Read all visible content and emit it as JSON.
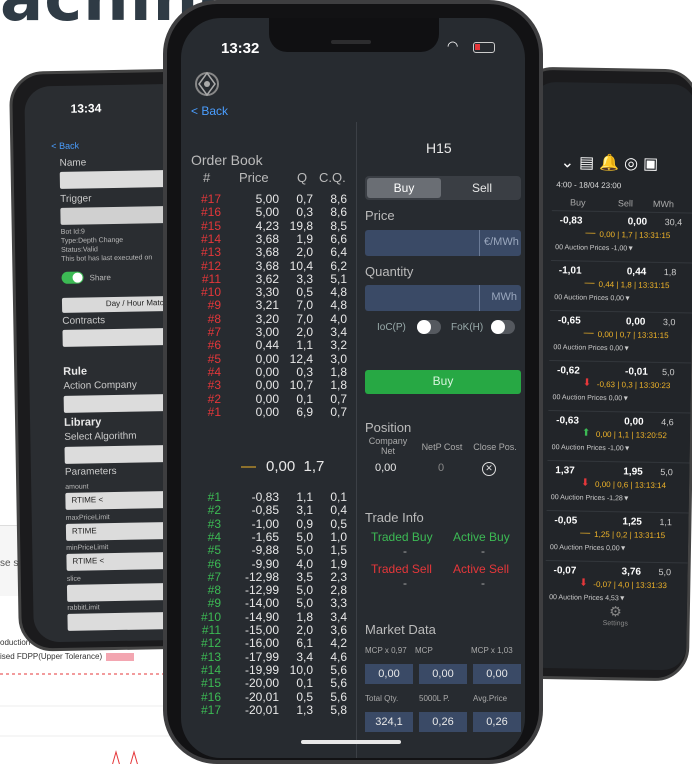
{
  "hero_title": "aching",
  "background_chart": {
    "snippet": "se s",
    "legend_production": "oduction",
    "legend_fdpp": "ised FDPP(Upper Tolerance)"
  },
  "left_phone": {
    "time": "13:34",
    "back": "< Back",
    "name_label": "Name",
    "trigger_label": "Trigger",
    "trigger_value": "Depth C",
    "bot_id": "Bot Id:9",
    "bot_type": "Type:Depth Change",
    "bot_status": "Status:Valid",
    "bot_last": "This bot has last executed on",
    "share_label": "Share",
    "day_hour_button": "Day / Hour Match",
    "contracts_label": "Contracts",
    "contracts_select": "Sele",
    "rule_heading": "Rule",
    "action_company_label": "Action Company",
    "library_heading": "Library",
    "select_algorithm_label": "Select Algorithm",
    "parameters_label": "Parameters",
    "amount_label": "amount",
    "amount_value": "RTIME <",
    "max_price_label": "maxPriceLimit",
    "max_price_value": "RTIME",
    "min_price_label": "minPriceLimit",
    "min_price_value": "RTIME <",
    "slice_label": "slice",
    "rabbit_label": "rabbitLimit"
  },
  "right_phone": {
    "date_range": "4:00 - 18/04 23:00",
    "headers": [
      "Buy",
      "Sell",
      "MWh"
    ],
    "settings_label": "Settings",
    "rows": [
      {
        "buy": "-0,83",
        "sell": "0,00",
        "mwh": "30,4",
        "detail": "0,00 | 1,7 | 13:31:15",
        "auction": "00  Auction Prices  -1,00▼",
        "arrow": "—",
        "arrow_color": "#f0b429"
      },
      {
        "buy": "-1,01",
        "sell": "0,44",
        "mwh": "1,8",
        "detail": "0,44 | 1,8 | 13:31:15",
        "auction": "00  Auction Prices  0,00▼",
        "arrow": "—",
        "arrow_color": "#f0b429"
      },
      {
        "buy": "-0,65",
        "sell": "0,00",
        "mwh": "3,0",
        "detail": "0,00 | 0,7 | 13:31:15",
        "auction": "00  Auction Prices  0,00▼",
        "arrow": "—",
        "arrow_color": "#f0b429"
      },
      {
        "buy": "-0,62",
        "sell": "-0,01",
        "mwh": "5,0",
        "detail": "-0,63 | 0,3 | 13:30:23",
        "auction": "00  Auction Prices  0,00▼",
        "arrow": "⬇",
        "arrow_color": "#e5373a"
      },
      {
        "buy": "-0,63",
        "sell": "0,00",
        "mwh": "4,6",
        "detail": "0,00 | 1,1 | 13:20:52",
        "auction": "00  Auction Prices  -1,00▼",
        "arrow": "⬆",
        "arrow_color": "#3cba54"
      },
      {
        "buy": "1,37",
        "sell": "1,95",
        "mwh": "5,0",
        "detail": "0,00 | 0,6 | 13:13:14",
        "auction": "00  Auction Prices  -1,28▼",
        "arrow": "⬇",
        "arrow_color": "#e5373a"
      },
      {
        "buy": "-0,05",
        "sell": "1,25",
        "mwh": "1,1",
        "detail": "1,25 | 0,2 | 13:31:15",
        "auction": "00  Auction Prices  0,00▼",
        "arrow": "—",
        "arrow_color": "#f0b429"
      },
      {
        "buy": "-0,07",
        "sell": "3,76",
        "mwh": "5,0",
        "detail": "-0,07 | 4,0 | 13:31:33",
        "auction": "00  Auction Prices  4,53▼",
        "arrow": "⬇",
        "arrow_color": "#e5373a"
      }
    ]
  },
  "center_phone": {
    "time": "13:32",
    "back": "< Back",
    "order_book_title": "Order Book",
    "columns": [
      "#",
      "Price",
      "Q",
      "C.Q."
    ],
    "sell_orders": [
      [
        "#17",
        "5,00",
        "0,7",
        "8,6"
      ],
      [
        "#16",
        "5,00",
        "0,3",
        "8,6"
      ],
      [
        "#15",
        "4,23",
        "19,8",
        "8,5"
      ],
      [
        "#14",
        "3,68",
        "1,9",
        "6,6"
      ],
      [
        "#13",
        "3,68",
        "2,0",
        "6,4"
      ],
      [
        "#12",
        "3,68",
        "10,4",
        "6,2"
      ],
      [
        "#11",
        "3,62",
        "3,3",
        "5,1"
      ],
      [
        "#10",
        "3,30",
        "0,5",
        "4,8"
      ],
      [
        "#9",
        "3,21",
        "7,0",
        "4,8"
      ],
      [
        "#8",
        "3,20",
        "7,0",
        "4,0"
      ],
      [
        "#7",
        "3,00",
        "2,0",
        "3,4"
      ],
      [
        "#6",
        "0,44",
        "1,1",
        "3,2"
      ],
      [
        "#5",
        "0,00",
        "12,4",
        "3,0"
      ],
      [
        "#4",
        "0,00",
        "0,3",
        "1,8"
      ],
      [
        "#3",
        "0,00",
        "10,7",
        "1,8"
      ],
      [
        "#2",
        "0,00",
        "0,1",
        "0,7"
      ],
      [
        "#1",
        "0,00",
        "6,9",
        "0,7"
      ]
    ],
    "mid_price": "0,00",
    "mid_qty": "1,7",
    "mid_dash": "—",
    "buy_orders": [
      [
        "#1",
        "-0,83",
        "1,1",
        "0,1"
      ],
      [
        "#2",
        "-0,85",
        "3,1",
        "0,4"
      ],
      [
        "#3",
        "-1,00",
        "0,9",
        "0,5"
      ],
      [
        "#4",
        "-1,65",
        "5,0",
        "1,0"
      ],
      [
        "#5",
        "-9,88",
        "5,0",
        "1,5"
      ],
      [
        "#6",
        "-9,90",
        "4,0",
        "1,9"
      ],
      [
        "#7",
        "-12,98",
        "3,5",
        "2,3"
      ],
      [
        "#8",
        "-12,99",
        "5,0",
        "2,8"
      ],
      [
        "#9",
        "-14,00",
        "5,0",
        "3,3"
      ],
      [
        "#10",
        "-14,90",
        "1,8",
        "3,4"
      ],
      [
        "#11",
        "-15,00",
        "2,0",
        "3,6"
      ],
      [
        "#12",
        "-16,00",
        "6,1",
        "4,2"
      ],
      [
        "#13",
        "-17,99",
        "3,4",
        "4,6"
      ],
      [
        "#14",
        "-19,99",
        "10,0",
        "5,6"
      ],
      [
        "#15",
        "-20,00",
        "0,1",
        "5,6"
      ],
      [
        "#16",
        "-20,01",
        "0,5",
        "5,6"
      ],
      [
        "#17",
        "-20,01",
        "1,3",
        "5,8"
      ]
    ],
    "contract": "H15",
    "buy_tab": "Buy",
    "sell_tab": "Sell",
    "price_label": "Price",
    "price_unit": "€/MWh",
    "quantity_label": "Quantity",
    "quantity_unit": "MWh",
    "ioc_label": "IoC(P)",
    "fok_label": "FoK(H)",
    "buy_button": "Buy",
    "position_label": "Position",
    "company_net_label": "Company Net",
    "netp_cost_label": "NetP Cost",
    "close_pos_label": "Close Pos.",
    "company_net_value": "0,00",
    "netp_cost_value": "0",
    "trade_info_label": "Trade Info",
    "traded_buy_label": "Traded Buy",
    "active_buy_label": "Active Buy",
    "traded_buy_value": "-",
    "active_buy_value": "-",
    "traded_sell_label": "Traded Sell",
    "active_sell_label": "Active Sell",
    "traded_sell_value": "-",
    "active_sell_value": "-",
    "market_data_label": "Market Data",
    "mcp_low_label": "MCP x 0,97",
    "mcp_label": "MCP",
    "mcp_high_label": "MCP x 1,03",
    "mcp_low_value": "0,00",
    "mcp_value": "0,00",
    "mcp_high_value": "0,00",
    "total_qty_label": "Total Qty.",
    "p5000_label": "5000L P.",
    "avg_price_label": "Avg.Price",
    "total_qty_value": "324,1",
    "p5000_value": "0,26",
    "avg_price_value": "0,26"
  },
  "colors": {
    "sell_red": "#e5373a",
    "buy_green": "#3cba54",
    "accent_yellow": "#f0b429",
    "input_blue": "#3a4a66",
    "link_blue": "#4a9eff"
  }
}
